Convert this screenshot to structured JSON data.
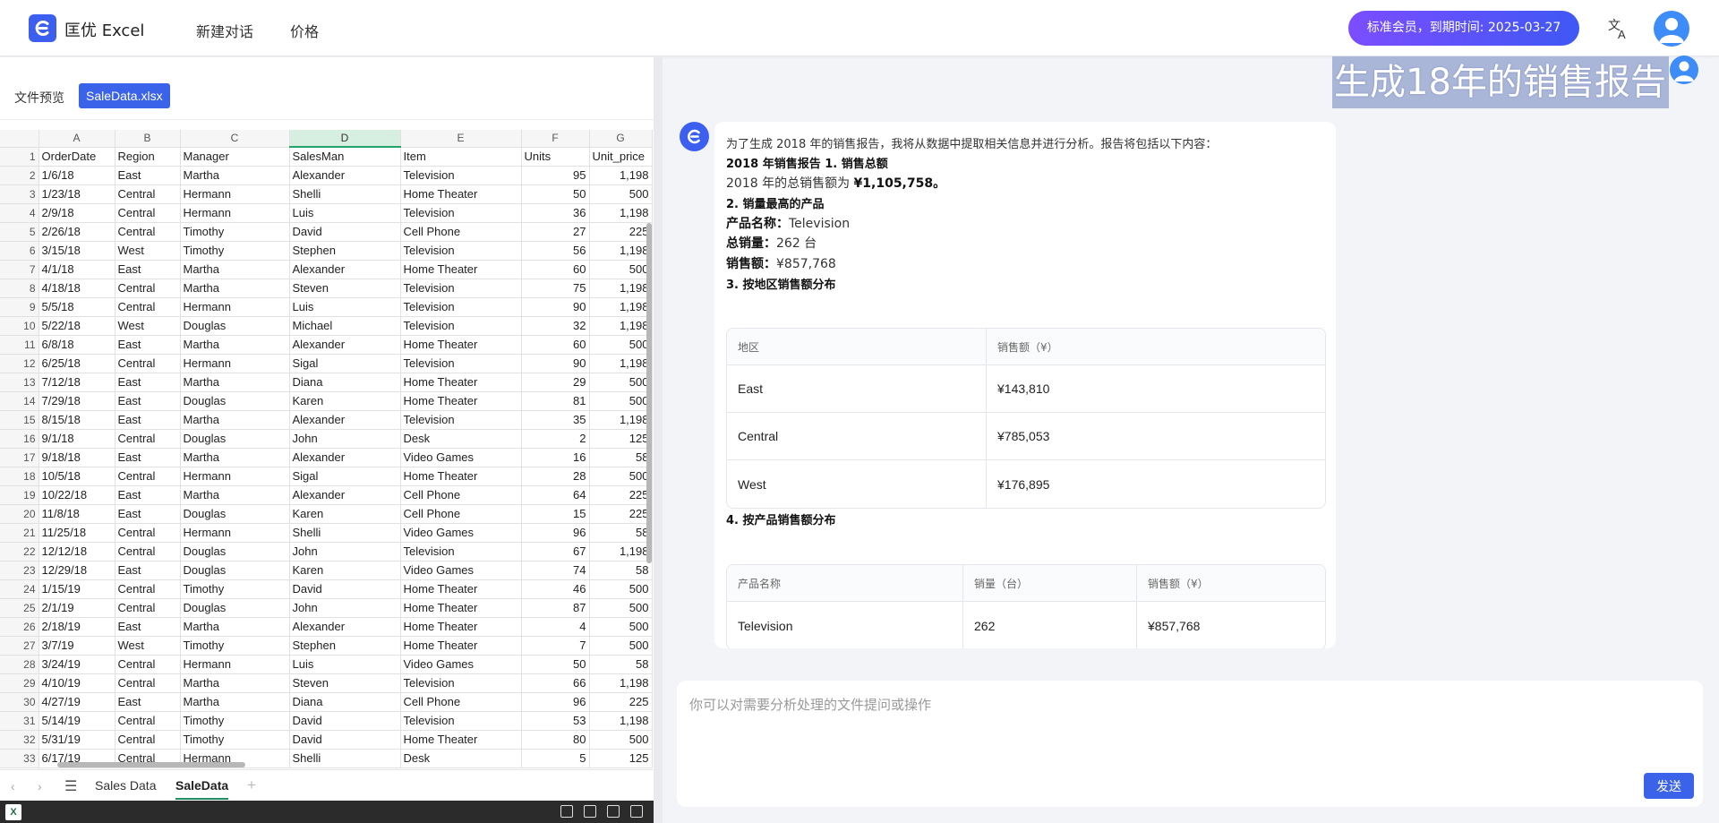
{
  "header": {
    "app_name": "匡优 Excel",
    "nav": [
      "新建对话",
      "价格"
    ],
    "membership": "标准会员，到期时间: 2025-03-27"
  },
  "preview": {
    "label": "文件预览",
    "file_name": "SaleData.xlsx"
  },
  "sheet": {
    "col_letters": [
      "A",
      "B",
      "C",
      "D",
      "E",
      "F",
      "G"
    ],
    "selected_col": "D",
    "headers": [
      "OrderDate",
      "Region",
      "Manager",
      "SalesMan",
      "Item",
      "Units",
      "Unit_price"
    ],
    "rows": [
      [
        "1/6/18",
        "East",
        "Martha",
        "Alexander",
        "Television",
        "95",
        "1,198"
      ],
      [
        "1/23/18",
        "Central",
        "Hermann",
        "Shelli",
        "Home Theater",
        "50",
        "500"
      ],
      [
        "2/9/18",
        "Central",
        "Hermann",
        "Luis",
        "Television",
        "36",
        "1,198"
      ],
      [
        "2/26/18",
        "Central",
        "Timothy",
        "David",
        "Cell Phone",
        "27",
        "225"
      ],
      [
        "3/15/18",
        "West",
        "Timothy",
        "Stephen",
        "Television",
        "56",
        "1,198"
      ],
      [
        "4/1/18",
        "East",
        "Martha",
        "Alexander",
        "Home Theater",
        "60",
        "500"
      ],
      [
        "4/18/18",
        "Central",
        "Martha",
        "Steven",
        "Television",
        "75",
        "1,198"
      ],
      [
        "5/5/18",
        "Central",
        "Hermann",
        "Luis",
        "Television",
        "90",
        "1,198"
      ],
      [
        "5/22/18",
        "West",
        "Douglas",
        "Michael",
        "Television",
        "32",
        "1,198"
      ],
      [
        "6/8/18",
        "East",
        "Martha",
        "Alexander",
        "Home Theater",
        "60",
        "500"
      ],
      [
        "6/25/18",
        "Central",
        "Hermann",
        "Sigal",
        "Television",
        "90",
        "1,198"
      ],
      [
        "7/12/18",
        "East",
        "Martha",
        "Diana",
        "Home Theater",
        "29",
        "500"
      ],
      [
        "7/29/18",
        "East",
        "Douglas",
        "Karen",
        "Home Theater",
        "81",
        "500"
      ],
      [
        "8/15/18",
        "East",
        "Martha",
        "Alexander",
        "Television",
        "35",
        "1,198"
      ],
      [
        "9/1/18",
        "Central",
        "Douglas",
        "John",
        "Desk",
        "2",
        "125"
      ],
      [
        "9/18/18",
        "East",
        "Martha",
        "Alexander",
        "Video Games",
        "16",
        "58"
      ],
      [
        "10/5/18",
        "Central",
        "Hermann",
        "Sigal",
        "Home Theater",
        "28",
        "500"
      ],
      [
        "10/22/18",
        "East",
        "Martha",
        "Alexander",
        "Cell Phone",
        "64",
        "225"
      ],
      [
        "11/8/18",
        "East",
        "Douglas",
        "Karen",
        "Cell Phone",
        "15",
        "225"
      ],
      [
        "11/25/18",
        "Central",
        "Hermann",
        "Shelli",
        "Video Games",
        "96",
        "58"
      ],
      [
        "12/12/18",
        "Central",
        "Douglas",
        "John",
        "Television",
        "67",
        "1,198"
      ],
      [
        "12/29/18",
        "East",
        "Douglas",
        "Karen",
        "Video Games",
        "74",
        "58"
      ],
      [
        "1/15/19",
        "Central",
        "Timothy",
        "David",
        "Home Theater",
        "46",
        "500"
      ],
      [
        "2/1/19",
        "Central",
        "Douglas",
        "John",
        "Home Theater",
        "87",
        "500"
      ],
      [
        "2/18/19",
        "East",
        "Martha",
        "Alexander",
        "Home Theater",
        "4",
        "500"
      ],
      [
        "3/7/19",
        "West",
        "Timothy",
        "Stephen",
        "Home Theater",
        "7",
        "500"
      ],
      [
        "3/24/19",
        "Central",
        "Hermann",
        "Luis",
        "Video Games",
        "50",
        "58"
      ],
      [
        "4/10/19",
        "Central",
        "Martha",
        "Steven",
        "Television",
        "66",
        "1,198"
      ],
      [
        "4/27/19",
        "East",
        "Martha",
        "Diana",
        "Cell Phone",
        "96",
        "225"
      ],
      [
        "5/14/19",
        "Central",
        "Timothy",
        "David",
        "Television",
        "53",
        "1,198"
      ],
      [
        "5/31/19",
        "Central",
        "Timothy",
        "David",
        "Home Theater",
        "80",
        "500"
      ],
      [
        "6/17/19",
        "Central",
        "Hermann",
        "Shelli",
        "Desk",
        "5",
        "125"
      ]
    ]
  },
  "sheet_tabs": {
    "tabs": [
      "Sales Data",
      "SaleData"
    ],
    "active": "SaleData"
  },
  "chat": {
    "question": "生成18年的销售报告",
    "answer": {
      "intro": "为了生成 2018 年的销售报告，我将从数据中提取相关信息并进行分析。报告将包括以下内容：",
      "h1": "2018 年销售报告 1. 销售总额",
      "total_prefix": "2018 年的总销售额为 ",
      "total_value": "¥1,105,758。",
      "h2": "2. 销量最高的产品",
      "top_name_label": "产品名称：",
      "top_name_value": "Television",
      "top_qty_label": "总销量：",
      "top_qty_value": "262 台",
      "top_sales_label": "销售额：",
      "top_sales_value": "¥857,768",
      "h3": "3. 按地区销售额分布",
      "region_table": {
        "headers": [
          "地区",
          "销售额（¥）"
        ],
        "rows": [
          [
            "East",
            "¥143,810"
          ],
          [
            "Central",
            "¥785,053"
          ],
          [
            "West",
            "¥176,895"
          ]
        ]
      },
      "h4": "4. 按产品销售额分布",
      "product_table": {
        "headers": [
          "产品名称",
          "销量（台）",
          "销售额（¥）"
        ],
        "rows": [
          [
            "Television",
            "262",
            "¥857,768"
          ]
        ]
      }
    }
  },
  "composer": {
    "placeholder": "你可以对需要分析处理的文件提问或操作",
    "send_label": "发送"
  }
}
